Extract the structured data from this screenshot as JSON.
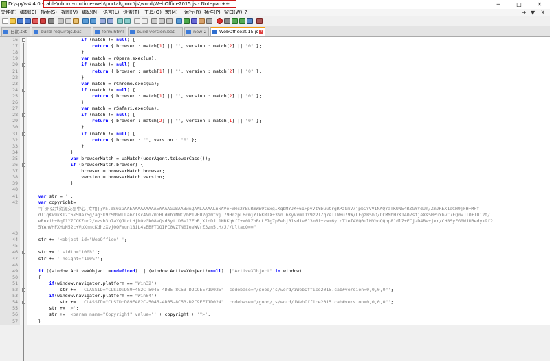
{
  "window": {
    "title_prefix": "D:\\spy\\v4.4.0.stable\\",
    "title_highlight": "obpm-runtime-web\\portal\\good\\js\\word\\WebOffice2015.js - Notepad++",
    "minimize": "─",
    "maximize": "□",
    "close": "✕"
  },
  "menu": {
    "items": [
      "文件(F)",
      "编辑(E)",
      "搜索(S)",
      "视图(V)",
      "编码(N)",
      "语言(L)",
      "设置(T)",
      "工具(O)",
      "宏(M)",
      "运行(R)",
      "插件(P)",
      "窗口(W)",
      "?"
    ],
    "right_plus": "+",
    "right_down": "▼",
    "right_close": "X"
  },
  "tabs": [
    {
      "label": "日期.txt"
    },
    {
      "label": "build-requirejs.bat"
    },
    {
      "label": "form.html"
    },
    {
      "label": "build-version.bat"
    },
    {
      "label": "new 2"
    },
    {
      "label": "WebOffice2015.js",
      "active": true
    }
  ],
  "code": [
    {
      "n": "16",
      "t": [
        [
          "",
          "                    "
        ],
        [
          "kw",
          "if"
        ],
        [
          "",
          " (match != "
        ],
        [
          "kw",
          "null"
        ],
        [
          "",
          ") {"
        ]
      ]
    },
    {
      "n": "17",
      "t": [
        [
          "",
          "                        "
        ],
        [
          "kw",
          "return"
        ],
        [
          "",
          " { browser : match["
        ],
        [
          "num",
          "1"
        ],
        [
          "",
          "] || "
        ],
        [
          "str",
          "\"\""
        ],
        [
          "",
          ", version : match["
        ],
        [
          "num",
          "2"
        ],
        [
          "",
          "] || "
        ],
        [
          "str",
          "\"0\""
        ],
        [
          "",
          " };"
        ]
      ]
    },
    {
      "n": "18",
      "t": [
        [
          "",
          "                    }"
        ]
      ]
    },
    {
      "n": "19",
      "t": [
        [
          "",
          "                    "
        ],
        [
          "kw",
          "var"
        ],
        [
          "",
          " match = rOpera.exec(ua);"
        ]
      ]
    },
    {
      "n": "20",
      "t": [
        [
          "",
          "                    "
        ],
        [
          "kw",
          "if"
        ],
        [
          "",
          " (match != "
        ],
        [
          "kw",
          "null"
        ],
        [
          "",
          ") {"
        ]
      ]
    },
    {
      "n": "21",
      "t": [
        [
          "",
          "                        "
        ],
        [
          "kw",
          "return"
        ],
        [
          "",
          " { browser : match["
        ],
        [
          "num",
          "1"
        ],
        [
          "",
          "] || "
        ],
        [
          "str",
          "\"\""
        ],
        [
          "",
          ", version : match["
        ],
        [
          "num",
          "2"
        ],
        [
          "",
          "] || "
        ],
        [
          "str",
          "\"0\""
        ],
        [
          "",
          " };"
        ]
      ]
    },
    {
      "n": "22",
      "t": [
        [
          "",
          "                    }"
        ]
      ]
    },
    {
      "n": "23",
      "t": [
        [
          "",
          "                    "
        ],
        [
          "kw",
          "var"
        ],
        [
          "",
          " match = rChrome.exec(ua);"
        ]
      ]
    },
    {
      "n": "24",
      "t": [
        [
          "",
          "                    "
        ],
        [
          "kw",
          "if"
        ],
        [
          "",
          " (match != "
        ],
        [
          "kw",
          "null"
        ],
        [
          "",
          ") {"
        ]
      ]
    },
    {
      "n": "25",
      "t": [
        [
          "",
          "                        "
        ],
        [
          "kw",
          "return"
        ],
        [
          "",
          " { browser : match["
        ],
        [
          "num",
          "1"
        ],
        [
          "",
          "] || "
        ],
        [
          "str",
          "\"\""
        ],
        [
          "",
          ", version : match["
        ],
        [
          "num",
          "2"
        ],
        [
          "",
          "] || "
        ],
        [
          "str",
          "\"0\""
        ],
        [
          "",
          " };"
        ]
      ]
    },
    {
      "n": "26",
      "t": [
        [
          "",
          "                    }"
        ]
      ]
    },
    {
      "n": "27",
      "t": [
        [
          "",
          "                    "
        ],
        [
          "kw",
          "var"
        ],
        [
          "",
          " match = rSafari.exec(ua);"
        ]
      ]
    },
    {
      "n": "28",
      "t": [
        [
          "",
          "                    "
        ],
        [
          "kw",
          "if"
        ],
        [
          "",
          " (match != "
        ],
        [
          "kw",
          "null"
        ],
        [
          "",
          ") {"
        ]
      ]
    },
    {
      "n": "29",
      "t": [
        [
          "",
          "                        "
        ],
        [
          "kw",
          "return"
        ],
        [
          "",
          " { browser : match["
        ],
        [
          "num",
          "2"
        ],
        [
          "",
          "] || "
        ],
        [
          "str",
          "\"\""
        ],
        [
          "",
          ", version : match["
        ],
        [
          "num",
          "1"
        ],
        [
          "",
          "] || "
        ],
        [
          "str",
          "\"0\""
        ],
        [
          "",
          " };"
        ]
      ]
    },
    {
      "n": "30",
      "t": [
        [
          "",
          "                    }"
        ]
      ]
    },
    {
      "n": "31",
      "t": [
        [
          "",
          "                    "
        ],
        [
          "kw",
          "if"
        ],
        [
          "",
          " (match != "
        ],
        [
          "kw",
          "null"
        ],
        [
          "",
          ") {"
        ]
      ]
    },
    {
      "n": "32",
      "t": [
        [
          "",
          "                        "
        ],
        [
          "kw",
          "return"
        ],
        [
          "",
          " { browser : "
        ],
        [
          "str",
          "\"\""
        ],
        [
          "",
          ", version : "
        ],
        [
          "str",
          "\"0\""
        ],
        [
          "",
          " };"
        ]
      ]
    },
    {
      "n": "33",
      "t": [
        [
          "",
          "                    }"
        ]
      ]
    },
    {
      "n": "34",
      "t": [
        [
          "",
          "                }"
        ]
      ]
    },
    {
      "n": "35",
      "t": [
        [
          "",
          "                "
        ],
        [
          "kw",
          "var"
        ],
        [
          "",
          " browserMatch = uaMatch(userAgent.toLowerCase());"
        ]
      ]
    },
    {
      "n": "36",
      "t": [
        [
          "",
          "                "
        ],
        [
          "kw",
          "if"
        ],
        [
          "",
          " (browserMatch.browser) {"
        ]
      ]
    },
    {
      "n": "37",
      "t": [
        [
          "",
          "                    browser = browserMatch.browser;"
        ]
      ]
    },
    {
      "n": "38",
      "t": [
        [
          "",
          "                    version = browserMatch.version;"
        ]
      ]
    },
    {
      "n": "39",
      "t": [
        [
          "",
          "                }"
        ]
      ]
    },
    {
      "n": "40",
      "t": [
        [
          "",
          ""
        ]
      ]
    },
    {
      "n": "41",
      "t": [
        [
          "",
          "    "
        ],
        [
          "kw",
          "var"
        ],
        [
          "",
          " str = "
        ],
        [
          "str",
          "''"
        ],
        [
          "",
          ";"
        ]
      ]
    },
    {
      "n": "42",
      "t": [
        [
          "",
          "    "
        ],
        [
          "kw",
          "var"
        ],
        [
          "",
          " copyright="
        ]
      ]
    },
    {
      "n": "",
      "t": [
        [
          "str",
          "    \"广州公共资源交易中心[专用];V5.0S0xGAAEAAAAAAAAAEAAAAGUBAABwAQAALAAAALnxAVeFWHc2rBuRmWB9tSxgIXqbMYJK+61FpvVtYbuutrgRPzSmV7jpbCYVVINAQYaTKUN54RZGYYdUm/ZmJREX1eCH9jFH+MHf"
        ]
      ]
    },
    {
      "n": "",
      "t": [
        [
          "str",
          "    dl1qKV9kKT2f6k5Da75g/ag3k9rSM9dLLa6rIsc4NmZ0GHLdmbiNWC/bP1VFU2gz0tvjJ79HrzpL6cmjYlkKRIX+3NnJ6KyVvmI1Y9z2lZq7eITW+u79W/LFgzB5bD/DCMMbH7K1407sfjeXs5HPuYGvC7FQ0vJI0+T012t/"
        ]
      ]
    },
    {
      "n": "",
      "t": [
        [
          "str",
          "    eRnxih+BqI1Y7CCKZuc2/ozsb3n7aYQJLcLHjNOvGk08eQsd3ytiD6e17FoBjXidDJt1NRKqKfI+W0kZhBuLE7g7pEehjB1sd1e6J3m8f+zwm6ytcT1ef4VQ0ulHVboQQbp81dlZ+ECjzD4Be+jxr/CH8SyFG0WJUBedyk9f2"
        ]
      ]
    },
    {
      "n": "",
      "t": [
        [
          "str",
          "    5YAhVHFXHuN52c+VpXmncKdhzXvj0QFWun18iL4sEBFTDQIPC0VZTN0IeeWVrZ3zn5tH/J//UltacQ==\""
        ]
      ]
    },
    {
      "n": "43",
      "t": [
        [
          "",
          ""
        ]
      ]
    },
    {
      "n": "44",
      "t": [
        [
          "",
          "    str += "
        ],
        [
          "str",
          "'<object id=\"WebOffice\" '"
        ],
        [
          "",
          ";"
        ]
      ]
    },
    {
      "n": "45",
      "t": [
        [
          "",
          ""
        ]
      ]
    },
    {
      "n": "46",
      "t": [
        [
          "",
          "    str += "
        ],
        [
          "str",
          "' width=\"100%\"'"
        ],
        [
          "",
          ";"
        ]
      ]
    },
    {
      "n": "47",
      "t": [
        [
          "",
          "    str += "
        ],
        [
          "str",
          "' height=\"100%\"'"
        ],
        [
          "",
          ";"
        ]
      ]
    },
    {
      "n": "48",
      "t": [
        [
          "",
          ""
        ]
      ]
    },
    {
      "n": "49",
      "t": [
        [
          "",
          "    "
        ],
        [
          "kw",
          "if"
        ],
        [
          "",
          " ((window.ActiveXObject!="
        ],
        [
          "kw",
          "undefined"
        ],
        [
          "",
          ") || (window.ActiveXObject!="
        ],
        [
          "kw",
          "null"
        ],
        [
          "",
          ") ||"
        ],
        [
          "str",
          "\"ActiveXObject\""
        ],
        [
          "",
          " "
        ],
        [
          "kw",
          "in"
        ],
        [
          "",
          " window)"
        ]
      ]
    },
    {
      "n": "50",
      "t": [
        [
          "",
          "    {"
        ]
      ]
    },
    {
      "n": "51",
      "t": [
        [
          "",
          "        "
        ],
        [
          "kw",
          "if"
        ],
        [
          "",
          "(window.navigator.platform == "
        ],
        [
          "str",
          "\"Win32\""
        ],
        [
          "",
          ")"
        ]
      ]
    },
    {
      "n": "52",
      "t": [
        [
          "",
          "            str += "
        ],
        [
          "str",
          "' CLASSID=\"CLSID:D89F482C-5045-4DB5-8C53-D2C9EE71D025\"  codebase=\"/good/js/word/iWebOffice2015.cab#version=0,0,0,0\"'"
        ],
        [
          "",
          ";"
        ]
      ]
    },
    {
      "n": "53",
      "t": [
        [
          "",
          "        "
        ],
        [
          "kw",
          "if"
        ],
        [
          "",
          "(window.navigator.platform == "
        ],
        [
          "str",
          "\"Win64\""
        ],
        [
          "",
          ")"
        ]
      ]
    },
    {
      "n": "54",
      "t": [
        [
          "",
          "            str += "
        ],
        [
          "str",
          "' CLASSID=\"CLSID:D89F482C-5045-4DB5-8C53-D2C9EE71D024\"  codebase=\"/good/js/word/iWebOffice2015.cab#version=0,0,0,0\"'"
        ],
        [
          "",
          ";"
        ]
      ]
    },
    {
      "n": "55",
      "t": [
        [
          "",
          "        str += "
        ],
        [
          "str",
          "'>'"
        ],
        [
          "",
          ";"
        ]
      ]
    },
    {
      "n": "56",
      "t": [
        [
          "",
          "        str += "
        ],
        [
          "str",
          "'<param name=\"Copyright\" value=\"'"
        ],
        [
          "",
          " + copyright + "
        ],
        [
          "str",
          "'\">'"
        ],
        [
          "",
          ";"
        ]
      ]
    },
    {
      "n": "57",
      "t": [
        [
          "",
          "    }"
        ]
      ]
    }
  ]
}
